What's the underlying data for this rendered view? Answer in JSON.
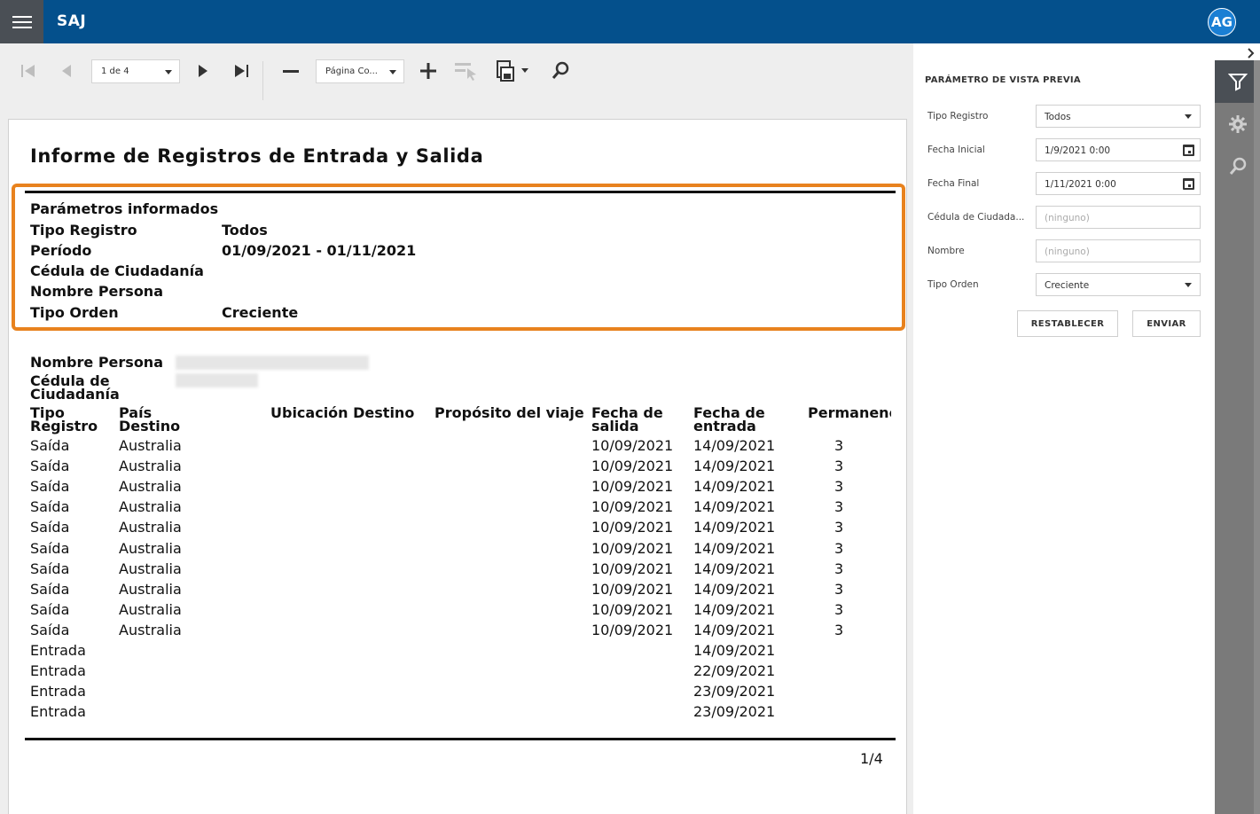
{
  "app": {
    "title": "SAJ",
    "avatar_initials": "AG"
  },
  "toolbar": {
    "page_selector": "1 de 4",
    "zoom_selector": "Página Co..."
  },
  "report": {
    "title": "Informe de Registros de Entrada y Salida",
    "params_heading": "Parámetros informados",
    "params": [
      {
        "label": "Tipo Registro",
        "value": "Todos"
      },
      {
        "label": "Período",
        "value": "01/09/2021 - 01/11/2021"
      },
      {
        "label": "Cédula de Ciudadanía",
        "value": ""
      },
      {
        "label": "Nombre Persona",
        "value": ""
      },
      {
        "label": "Tipo Orden",
        "value": "Creciente"
      }
    ],
    "person_labels": {
      "nombre": "Nombre Persona",
      "cedula_line1": "Cédula de",
      "cedula_line2": "Ciudadanía"
    },
    "columns": {
      "tipo_1": "Tipo",
      "tipo_2": "Registro",
      "pais_1": "País",
      "pais_2": "Destino",
      "ubicacion": "Ubicación Destino",
      "proposito": "Propósito del viaje",
      "salida_1": "Fecha de",
      "salida_2": "salida",
      "entrada_1": "Fecha de",
      "entrada_2": "entrada",
      "permanencia": "Permanenc"
    },
    "rows": [
      {
        "tipo": "Saída",
        "pais": "Australia",
        "salida": "10/09/2021",
        "entrada": "14/09/2021",
        "perm": "3"
      },
      {
        "tipo": "Saída",
        "pais": "Australia",
        "salida": "10/09/2021",
        "entrada": "14/09/2021",
        "perm": "3"
      },
      {
        "tipo": "Saída",
        "pais": "Australia",
        "salida": "10/09/2021",
        "entrada": "14/09/2021",
        "perm": "3"
      },
      {
        "tipo": "Saída",
        "pais": "Australia",
        "salida": "10/09/2021",
        "entrada": "14/09/2021",
        "perm": "3"
      },
      {
        "tipo": "Saída",
        "pais": "Australia",
        "salida": "10/09/2021",
        "entrada": "14/09/2021",
        "perm": "3"
      },
      {
        "tipo": "Saída",
        "pais": "Australia",
        "salida": "10/09/2021",
        "entrada": "14/09/2021",
        "perm": "3"
      },
      {
        "tipo": "Saída",
        "pais": "Australia",
        "salida": "10/09/2021",
        "entrada": "14/09/2021",
        "perm": "3"
      },
      {
        "tipo": "Saída",
        "pais": "Australia",
        "salida": "10/09/2021",
        "entrada": "14/09/2021",
        "perm": "3"
      },
      {
        "tipo": "Saída",
        "pais": "Australia",
        "salida": "10/09/2021",
        "entrada": "14/09/2021",
        "perm": "3"
      },
      {
        "tipo": "Saída",
        "pais": "Australia",
        "salida": "10/09/2021",
        "entrada": "14/09/2021",
        "perm": "3"
      },
      {
        "tipo": "Entrada",
        "pais": "",
        "salida": "",
        "entrada": "14/09/2021",
        "perm": ""
      },
      {
        "tipo": "Entrada",
        "pais": "",
        "salida": "",
        "entrada": "22/09/2021",
        "perm": ""
      },
      {
        "tipo": "Entrada",
        "pais": "",
        "salida": "",
        "entrada": "23/09/2021",
        "perm": ""
      },
      {
        "tipo": "Entrada",
        "pais": "",
        "salida": "",
        "entrada": "23/09/2021",
        "perm": ""
      }
    ],
    "page_number": "1/4"
  },
  "panel": {
    "title": "PARÁMETRO DE VISTA PREVIA",
    "fields": {
      "tipo_registro": {
        "label": "Tipo Registro",
        "value": "Todos"
      },
      "fecha_inicial": {
        "label": "Fecha Inicial",
        "value": "1/9/2021 0:00"
      },
      "fecha_final": {
        "label": "Fecha Final",
        "value": "1/11/2021 0:00"
      },
      "cedula": {
        "label": "Cédula de Ciudada...",
        "placeholder": "(ninguno)"
      },
      "nombre": {
        "label": "Nombre",
        "placeholder": "(ninguno)"
      },
      "tipo_orden": {
        "label": "Tipo Orden",
        "value": "Creciente"
      }
    },
    "reset_label": "RESTABLECER",
    "submit_label": "ENVIAR"
  }
}
